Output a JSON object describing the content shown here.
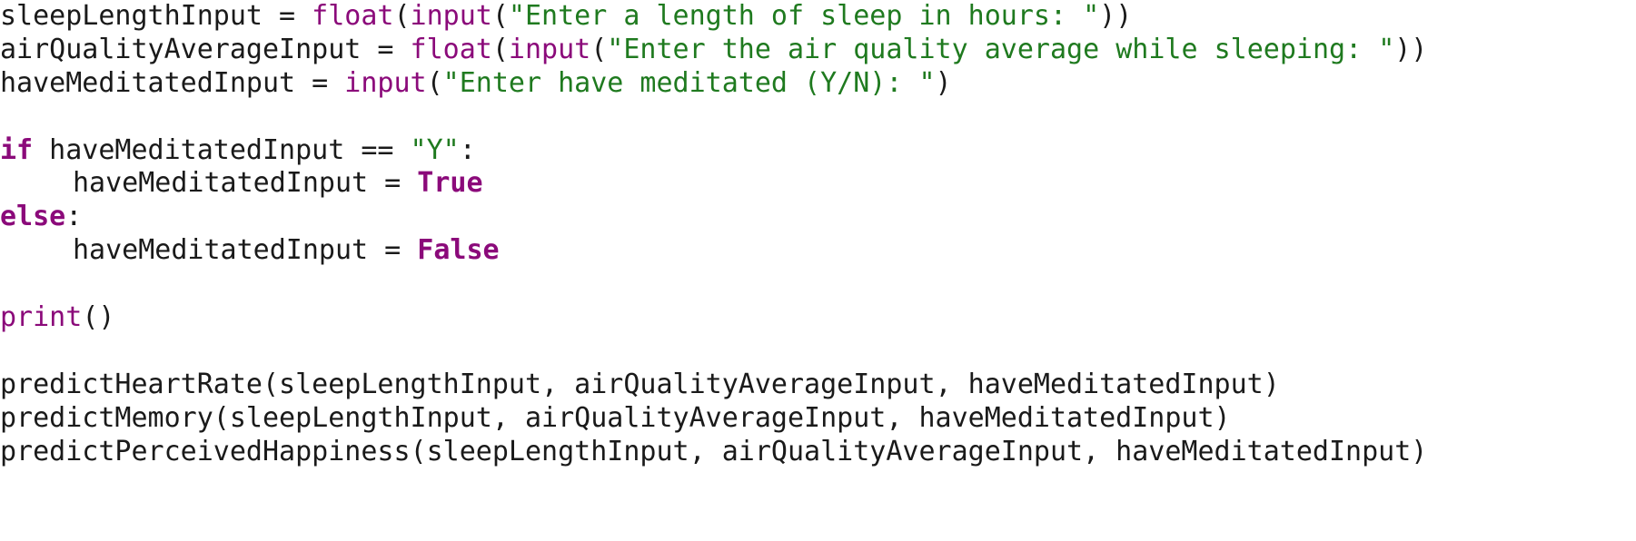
{
  "code_lines": {
    "l1": {
      "var": "sleepLengthInput",
      "op": " = ",
      "fn1": "float",
      "p1": "(",
      "fn2": "input",
      "p2": "(",
      "str": "\"Enter a length of sleep in hours: \"",
      "close": "))"
    },
    "l2": {
      "var": "airQualityAverageInput",
      "op": " = ",
      "fn1": "float",
      "p1": "(",
      "fn2": "input",
      "p2": "(",
      "str": "\"Enter the air quality average while sleeping: \"",
      "close": "))"
    },
    "l3": {
      "var": "haveMeditatedInput",
      "op": " = ",
      "fn": "input",
      "p": "(",
      "str": "\"Enter have meditated (Y/N): \"",
      "close": ")"
    },
    "l5": {
      "kw": "if",
      "rest": " haveMeditatedInput == ",
      "str": "\"Y\"",
      "colon": ":"
    },
    "l6": {
      "var": "haveMeditatedInput",
      "op": " = ",
      "kw": "True"
    },
    "l7": {
      "kw": "else",
      "colon": ":"
    },
    "l8": {
      "var": "haveMeditatedInput",
      "op": " = ",
      "kw": "False"
    },
    "l10": {
      "fn": "print",
      "args": "()"
    },
    "l12": {
      "text": "predictHeartRate(sleepLengthInput, airQualityAverageInput, haveMeditatedInput)"
    },
    "l13": {
      "text": "predictMemory(sleepLengthInput, airQualityAverageInput, haveMeditatedInput)"
    },
    "l14": {
      "text": "predictPerceivedHappiness(sleepLengthInput, airQualityAverageInput, haveMeditatedInput)"
    }
  },
  "colors": {
    "function": "#8b0a7a",
    "keyword": "#8b0a7a",
    "string": "#1f7a1f",
    "text": "#1a1a1a",
    "background": "#ffffff"
  }
}
